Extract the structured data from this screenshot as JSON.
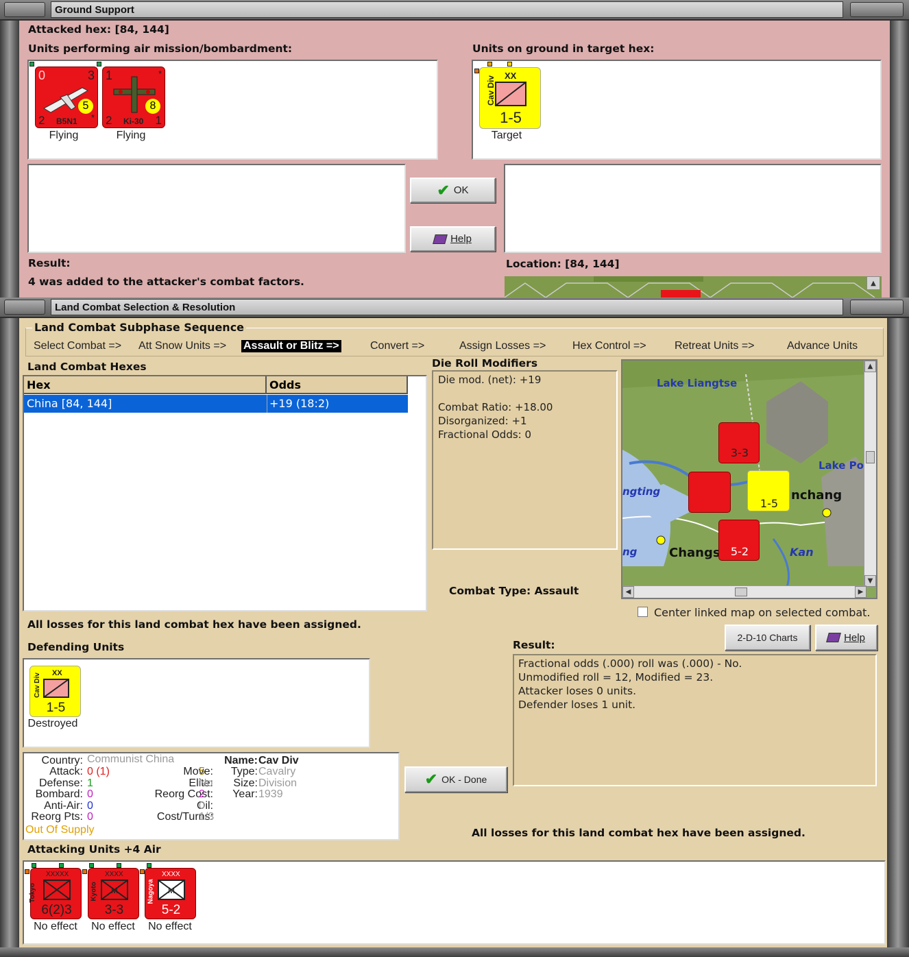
{
  "win1": {
    "title": "Ground Support",
    "attacked_hex": "Attacked hex:  [84, 144]",
    "units_air_label": "Units performing air mission/bombardment:",
    "units_ground_label": "Units on ground in target hex:",
    "air_units": [
      {
        "name": "B5N1",
        "corner_tl": "0",
        "corner_tr": "3",
        "corner_bl": "2",
        "corner_br": "*",
        "factor": "5",
        "status": "Flying"
      },
      {
        "name": "Ki-30",
        "corner_tl": "1",
        "corner_tr": "*",
        "corner_bl": "2",
        "corner_br": "1",
        "factor": "8",
        "status": "Flying"
      }
    ],
    "ground_unit": {
      "side": "Cav Div",
      "size": "XX",
      "strength": "1-5",
      "status": "Target"
    },
    "ok_label": "OK",
    "help_label": "Help",
    "result_label": "Result:",
    "result_text": "4 was added to the attacker's combat factors.",
    "location_label": "Location:  [84, 144]"
  },
  "win2": {
    "title": "Land Combat Selection & Resolution",
    "sequence_label": "Land Combat Subphase Sequence",
    "sequence": [
      "Select Combat =>",
      "Att Snow Units =>",
      "Assault or Blitz =>",
      "Convert =>",
      "Assign Losses =>",
      "Hex Control =>",
      "Retreat Units =>",
      "Advance Units"
    ],
    "active_step": "Assault or Blitz =>",
    "hexes_label": "Land Combat Hexes",
    "table": {
      "headers": [
        "Hex",
        "Odds"
      ],
      "rows": [
        [
          "China [84, 144]",
          "+19 (18:2)"
        ]
      ]
    },
    "drm_label": "Die Roll Modifiers",
    "drm_lines": [
      "Die mod. (net): +19",
      "",
      "Combat Ratio: +18.00",
      "Disorganized: +1",
      "Fractional Odds: 0"
    ],
    "combat_type": "Combat Type:  Assault",
    "center_map_label": "Center linked map on selected combat.",
    "losses_msg": "All losses for this land combat hex have been assigned.",
    "charts_label": "2-D-10 Charts",
    "help_label": "Help",
    "defending_label": "Defending Units",
    "defender": {
      "side": "Cav Div",
      "size": "XX",
      "strength": "1-5",
      "status": "Destroyed"
    },
    "result_label": "Result:",
    "result_lines": [
      "Fractional odds (.000) roll was (.000)  - No.",
      "Unmodified roll = 12, Modified = 23.",
      "Attacker loses 0 units.",
      "Defender loses 1 unit."
    ],
    "ok_done_label": "OK - Done",
    "losses_msg2": "All losses for this land combat hex have been assigned.",
    "unit_info": {
      "country_k": "Country:",
      "country_v": "Communist China",
      "attack_k": "Attack:",
      "attack_v": "0 (1)",
      "defense_k": "Defense:",
      "defense_v": "1",
      "bombard_k": "Bombard:",
      "bombard_v": "0",
      "antiair_k": "Anti-Air:",
      "antiair_v": "0",
      "reorg_pts_k": "Reorg Pts:",
      "reorg_pts_v": "0",
      "supply": "Out Of Supply",
      "move_k": "Move:",
      "move_v": "5",
      "elite_k": "Elite:",
      "elite_v": "No",
      "reorg_cost_k": "Reorg Cost:",
      "reorg_cost_v": "2",
      "oil_k": "Oil:",
      "oil_v": "0",
      "cost_turns_k": "Cost/Turns:",
      "cost_turns_v": "1/3",
      "name_k": "Name:",
      "name_v": "Cav Div",
      "type_k": "Type:",
      "type_v": "Cavalry",
      "size_k": "Size:",
      "size_v": "Division",
      "year_k": "Year:",
      "year_v": "1939"
    },
    "attacking_label": "Attacking Units +4 Air",
    "attackers": [
      {
        "hq": "Tokyo",
        "size": "XXXXX",
        "strength": "6(2)3",
        "status": "No effect"
      },
      {
        "hq": "Kyoto",
        "size": "XXXX",
        "strength": "3-3",
        "status": "No effect"
      },
      {
        "hq": "Nagoya",
        "size": "XXXX",
        "strength": "5-2",
        "status": "No effect"
      }
    ],
    "map_labels": {
      "lake1": "Lake Liangtse",
      "lake2": "Lake Po",
      "city1": "nchang",
      "city2": "Changs",
      "city3": "Kan",
      "city4": "ngting",
      "city5": "ng"
    }
  },
  "colors": {
    "pink_bg": "#dcaeae",
    "tan_bg": "#e4d2ab",
    "selection": "#0a64d8",
    "counter_red": "#e8141a",
    "counter_yellow": "#ffff00"
  }
}
